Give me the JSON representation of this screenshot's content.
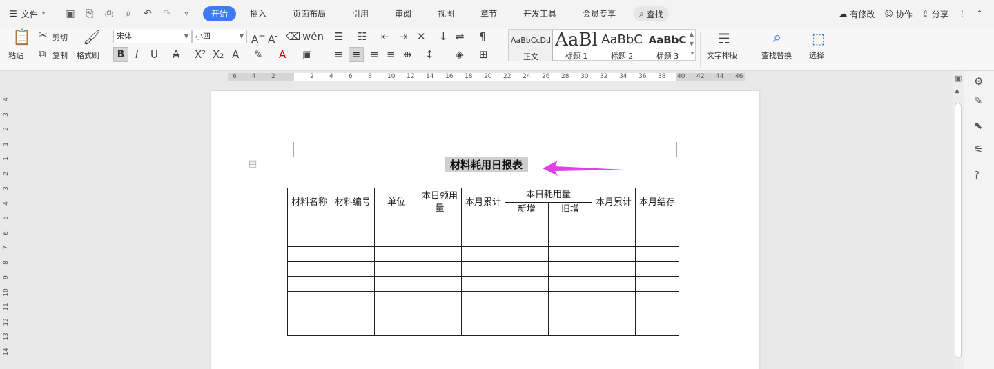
{
  "menubar": {
    "file_label": "文件",
    "tabs": [
      "开始",
      "插入",
      "页面布局",
      "引用",
      "审阅",
      "视图",
      "章节",
      "开发工具",
      "会员专享"
    ],
    "active_tab": "开始",
    "search_label": "查找",
    "right": {
      "modified": "有修改",
      "collaborate": "协作",
      "share": "分享"
    }
  },
  "ribbon": {
    "paste": "粘贴",
    "cut": "剪切",
    "copy": "复制",
    "format_painter": "格式刷",
    "font_name": "宋体",
    "font_size": "小四",
    "styles": [
      {
        "sample": "AaBbCcDd",
        "name": "正文"
      },
      {
        "sample": "AaBl",
        "name": "标题 1"
      },
      {
        "sample": "AaBbC",
        "name": "标题 2"
      },
      {
        "sample": "AaBbC",
        "name": "标题 3"
      }
    ],
    "text_layout": "文字排版",
    "find_replace": "查找替换",
    "select": "选择"
  },
  "ruler": {
    "h_ticks": [
      "6",
      "4",
      "2",
      "2",
      "4",
      "6",
      "8",
      "10",
      "12",
      "14",
      "16",
      "18",
      "20",
      "22",
      "24",
      "26",
      "28",
      "30",
      "32",
      "34",
      "36",
      "38",
      "40",
      "42",
      "44",
      "46"
    ],
    "v_ticks": [
      "4",
      "3",
      "2",
      "1",
      "1",
      "2",
      "3",
      "4",
      "5",
      "6",
      "7",
      "8",
      "9",
      "10",
      "11",
      "12",
      "13",
      "14"
    ]
  },
  "document": {
    "title": "材料耗用日报表",
    "table": {
      "col_material_name": "材料名称",
      "col_material_no": "材料编号",
      "col_unit": "单位",
      "col_today_receive": "本日领用量",
      "col_month_total": "本月累计",
      "col_today_consume": "本日耗用量",
      "sub_new": "新增",
      "sub_old": "旧增",
      "col_month_total2": "本月累计",
      "col_month_stock": "本月结存",
      "empty_rows": 8
    }
  },
  "colors": {
    "accent": "#3d7cf0",
    "arrow": "#e040e8"
  }
}
